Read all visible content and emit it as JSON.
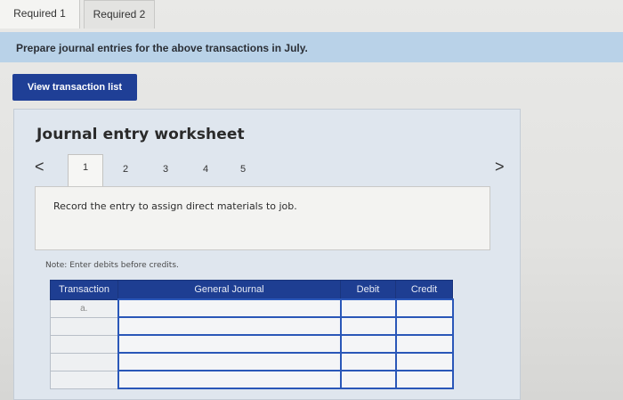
{
  "tabs": [
    {
      "label": "Required 1"
    },
    {
      "label": "Required 2"
    }
  ],
  "instruction": "Prepare journal entries for the above transactions in July.",
  "view_button": "View transaction list",
  "worksheet": {
    "title": "Journal entry worksheet",
    "prev_glyph": "<",
    "next_glyph": ">",
    "pages": [
      "1",
      "2",
      "3",
      "4",
      "5"
    ],
    "active_page": "1",
    "entry_text": "Record the entry to assign direct materials to job.",
    "note": "Note: Enter debits before credits."
  },
  "table": {
    "headers": [
      "Transaction",
      "General Journal",
      "Debit",
      "Credit"
    ],
    "rows": [
      {
        "transaction": "a.",
        "account": "",
        "debit": "",
        "credit": ""
      },
      {
        "transaction": "",
        "account": "",
        "debit": "",
        "credit": ""
      },
      {
        "transaction": "",
        "account": "",
        "debit": "",
        "credit": ""
      },
      {
        "transaction": "",
        "account": "",
        "debit": "",
        "credit": ""
      },
      {
        "transaction": "",
        "account": "",
        "debit": "",
        "credit": ""
      }
    ]
  },
  "colors": {
    "banner": "#b9d2e8",
    "button": "#1f3f96",
    "table_header": "#1e3e92",
    "panel": "#dfe6ee"
  }
}
